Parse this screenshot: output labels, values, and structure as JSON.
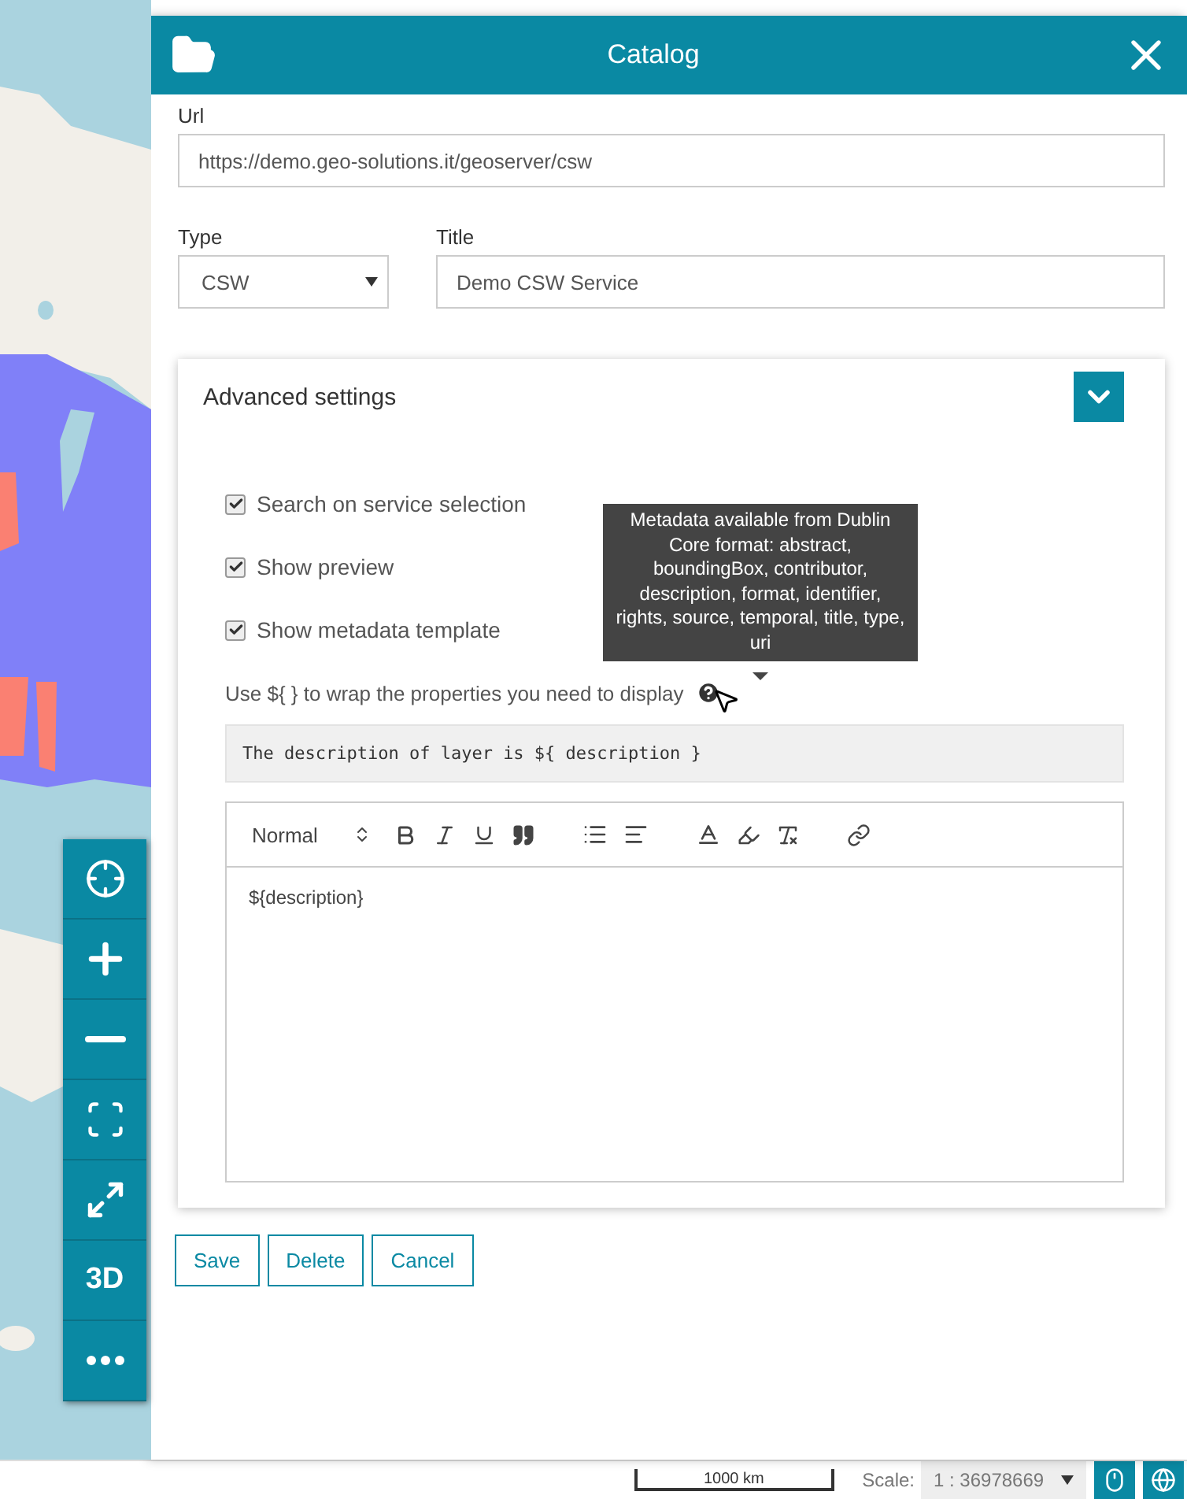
{
  "panel": {
    "title": "Catalog"
  },
  "url": {
    "label": "Url",
    "value": "https://demo.geo-solutions.it/geoserver/csw"
  },
  "type": {
    "label": "Type",
    "value": "CSW"
  },
  "title": {
    "label": "Title",
    "value": "Demo CSW Service"
  },
  "advanced": {
    "title": "Advanced settings",
    "expanded": true,
    "options": [
      {
        "label": "Search on service selection",
        "checked": true
      },
      {
        "label": "Show preview",
        "checked": true
      },
      {
        "label": "Show metadata template",
        "checked": true
      }
    ],
    "hint": "Use ${ } to wrap the properties you need to display",
    "tooltip": "Metadata available from Dublin Core format: abstract, boundingBox, contributor, description, format, identifier, rights, source, temporal, title, type, uri",
    "example": "The description of layer is ${ description }",
    "editor": {
      "format": "Normal",
      "content": "${description}"
    }
  },
  "buttons": [
    "Save",
    "Delete",
    "Cancel"
  ],
  "map_tools": [
    {
      "kind": "locate"
    },
    {
      "kind": "zoom-in"
    },
    {
      "kind": "zoom-out"
    },
    {
      "kind": "extent"
    },
    {
      "kind": "fullscreen"
    },
    {
      "kind": "text",
      "label": "3D"
    },
    {
      "kind": "more"
    }
  ],
  "footer": {
    "scale_bar": "1000 km",
    "scale_label": "Scale:",
    "scale_value": "1 : 36978669"
  }
}
